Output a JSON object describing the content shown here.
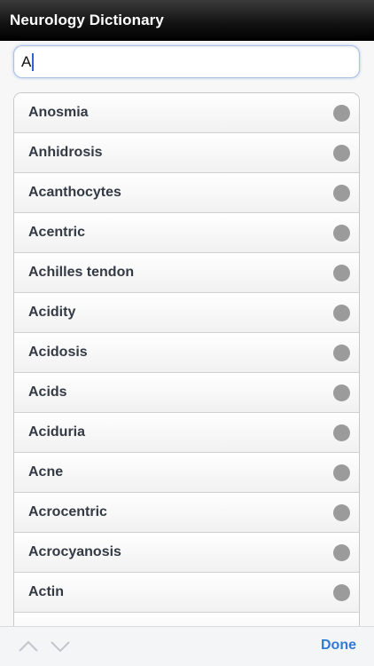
{
  "title_bar": {
    "title": "Neurology Dictionary"
  },
  "search": {
    "value": "A"
  },
  "results": [
    {
      "label": "Anosmia"
    },
    {
      "label": "Anhidrosis"
    },
    {
      "label": "Acanthocytes"
    },
    {
      "label": "Acentric"
    },
    {
      "label": "Achilles tendon"
    },
    {
      "label": "Acidity"
    },
    {
      "label": "Acidosis"
    },
    {
      "label": "Acids"
    },
    {
      "label": "Aciduria"
    },
    {
      "label": "Acne"
    },
    {
      "label": "Acrocentric"
    },
    {
      "label": "Acrocyanosis"
    },
    {
      "label": "Actin"
    }
  ],
  "keyboard_toolbar": {
    "previous_icon": "chevron-up-icon",
    "next_icon": "chevron-down-icon",
    "done_label": "Done"
  },
  "colors": {
    "title_bar_bg": "#000000",
    "accent": "#2f7bd7",
    "row_dot": "#9b9b9b"
  }
}
